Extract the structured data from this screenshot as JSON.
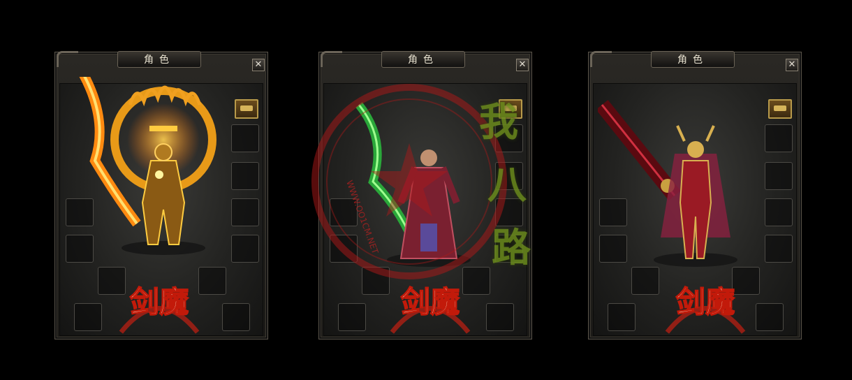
{
  "panels": [
    {
      "title": "角色",
      "close": "✕",
      "theme": "gold"
    },
    {
      "title": "角色",
      "close": "✕",
      "theme": "green"
    },
    {
      "title": "角色",
      "close": "✕",
      "theme": "crimson"
    }
  ],
  "logo_text": "剑魔",
  "watermark": {
    "ring_text": "WWW.OO1CM.NET",
    "chars": [
      "我",
      "八",
      "路"
    ]
  },
  "colors": {
    "gold": "#f0a020",
    "green": "#3ed04a",
    "crimson": "#b8182a",
    "logo_stroke": "#c21a0a"
  }
}
